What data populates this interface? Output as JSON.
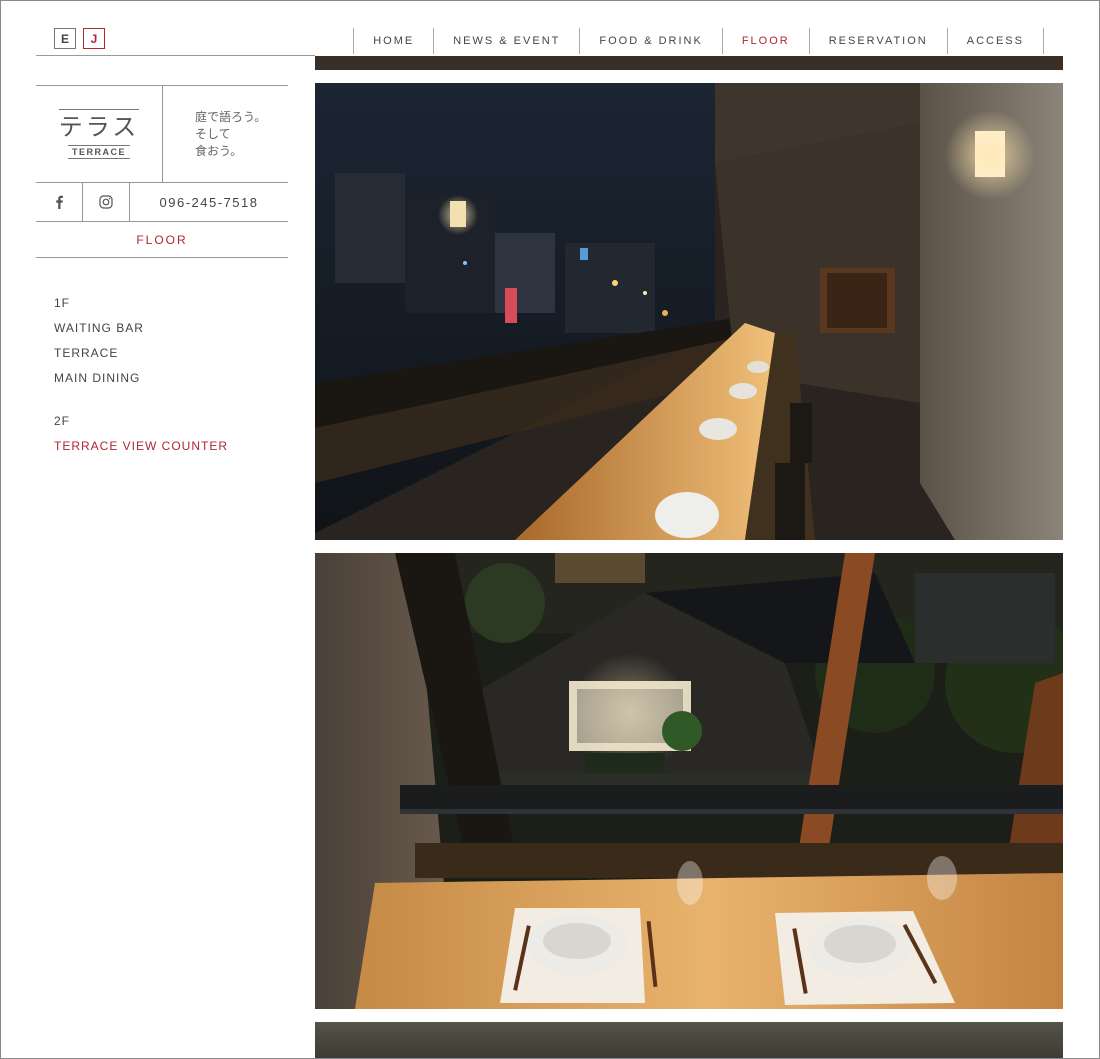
{
  "language": {
    "options": [
      "E",
      "J"
    ],
    "active": "J"
  },
  "nav": {
    "items": [
      {
        "label": "HOME"
      },
      {
        "label": "NEWS & EVENT"
      },
      {
        "label": "FOOD & DRINK"
      },
      {
        "label": "FLOOR",
        "active": true
      },
      {
        "label": "RESERVATION"
      },
      {
        "label": "ACCESS"
      }
    ]
  },
  "brand": {
    "logo_jp": "テラス",
    "logo_en": "TERRACE",
    "tagline": [
      "庭で語ろう。",
      "そして",
      "食おう。"
    ]
  },
  "contact": {
    "facebook_icon": "facebook-icon",
    "instagram_icon": "instagram-icon",
    "phone": "096-245-7518"
  },
  "section_title": "FLOOR",
  "floors": [
    {
      "label": "1F",
      "items": [
        "WAITING BAR",
        "TERRACE",
        "MAIN DINING"
      ]
    },
    {
      "label": "2F",
      "items": [
        "TERRACE VIEW COUNTER"
      ],
      "active_item": "TERRACE VIEW COUNTER"
    }
  ],
  "colors": {
    "accent": "#b0262e",
    "rule": "#999999",
    "text": "#444444"
  }
}
